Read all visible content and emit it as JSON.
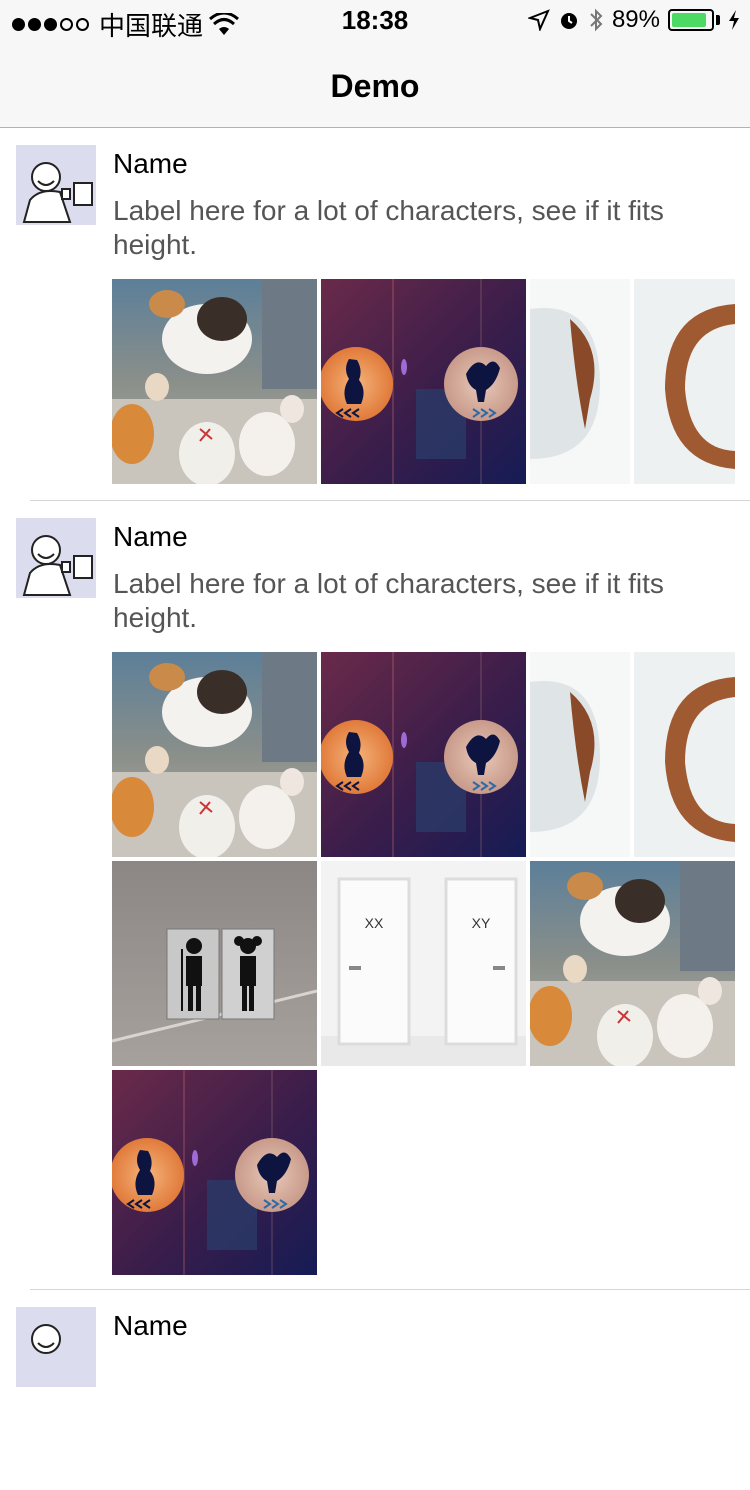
{
  "status_bar": {
    "carrier": "中国联通",
    "time": "18:38",
    "battery_percent": "89%",
    "battery_level": 0.89,
    "signal_bars_filled": 3,
    "signal_bars_total": 5
  },
  "nav": {
    "title": "Demo"
  },
  "feed": [
    {
      "name": "Name",
      "label": "Label here for a lot of characters, see if it fits height.",
      "images": [
        "cats-photo",
        "cat-rooster-photo",
        "wooden-circle-photo"
      ]
    },
    {
      "name": "Name",
      "label": "Label here for a lot of characters, see if it fits height.",
      "images": [
        "cats-photo",
        "cat-rooster-photo",
        "wooden-circle-photo",
        "restroom-sign-photo",
        "doors-photo",
        "cats-photo",
        "cat-rooster-photo"
      ],
      "door_labels": [
        "XX",
        "XY"
      ]
    },
    {
      "name": "Name"
    }
  ]
}
